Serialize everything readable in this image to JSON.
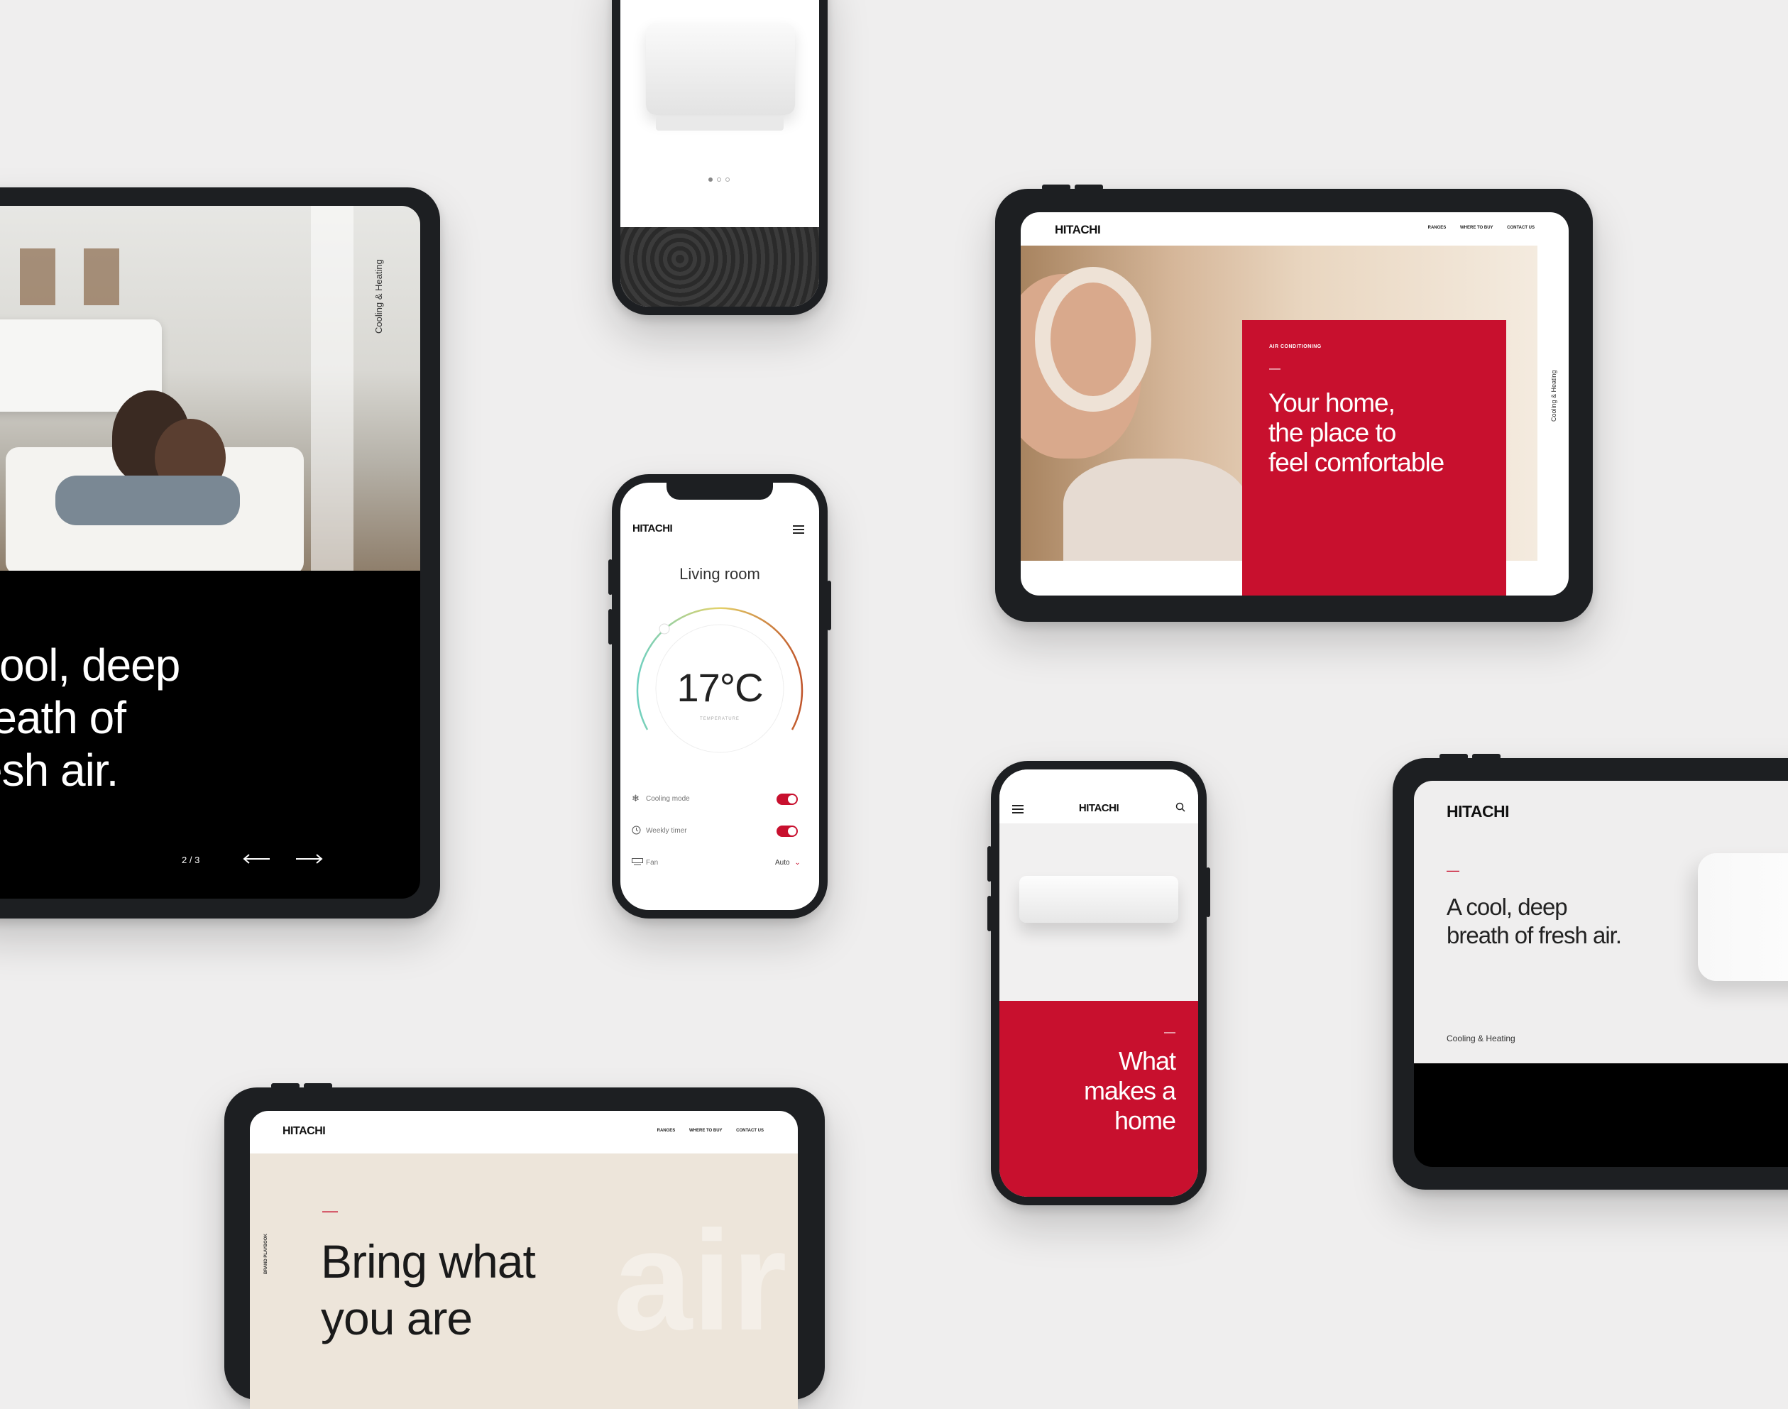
{
  "brand": {
    "logo": "HITACHI",
    "accent": "#c8102e",
    "cream": "#ede5da"
  },
  "tablet_left": {
    "vertical": "Cooling & Heating",
    "headline_lines": [
      "cool, deep",
      "reath of",
      "esh air."
    ],
    "pager": "2 / 3",
    "prev_icon": "arrow-left-icon",
    "next_icon": "arrow-right-icon"
  },
  "phone_top": {
    "dots": 3
  },
  "tablet_top_right": {
    "nav": [
      "RANGES",
      "WHERE TO BUY",
      "CONTACT US"
    ],
    "eyebrow": "AIR CONDITIONING",
    "dash": "—",
    "headline_lines": [
      "Your home,",
      "the place to",
      "feel comfortable"
    ],
    "vertical": "Cooling & Heating"
  },
  "phone_center": {
    "menu_icon": "hamburger-icon",
    "room": "Living room",
    "temperature": "17°C",
    "temperature_label": "TEMPERATURE",
    "settings": [
      {
        "icon": "snowflake-icon",
        "label": "Cooling mode",
        "type": "toggle"
      },
      {
        "icon": "clock-icon",
        "label": "Weekly timer",
        "type": "toggle"
      },
      {
        "icon": "fan-icon",
        "label": "Fan",
        "type": "select",
        "value": "Auto"
      }
    ]
  },
  "phone_bottom": {
    "menu_icon": "hamburger-icon",
    "search_icon": "search-icon",
    "dash": "—",
    "headline_lines": [
      "What",
      "makes a",
      "home"
    ]
  },
  "tablet_bottom_right": {
    "dash": "—",
    "headline_lines": [
      "A cool, deep",
      "breath of fresh air."
    ],
    "footer": "Cooling & Heating"
  },
  "tablet_bottom_left": {
    "nav": [
      "RANGES",
      "WHERE TO BUY",
      "CONTACT US"
    ],
    "vertical": "BRAND PLAYBOOK",
    "dash": "—",
    "headline_lines": [
      "Bring what",
      "you are"
    ],
    "watermark": "air"
  }
}
